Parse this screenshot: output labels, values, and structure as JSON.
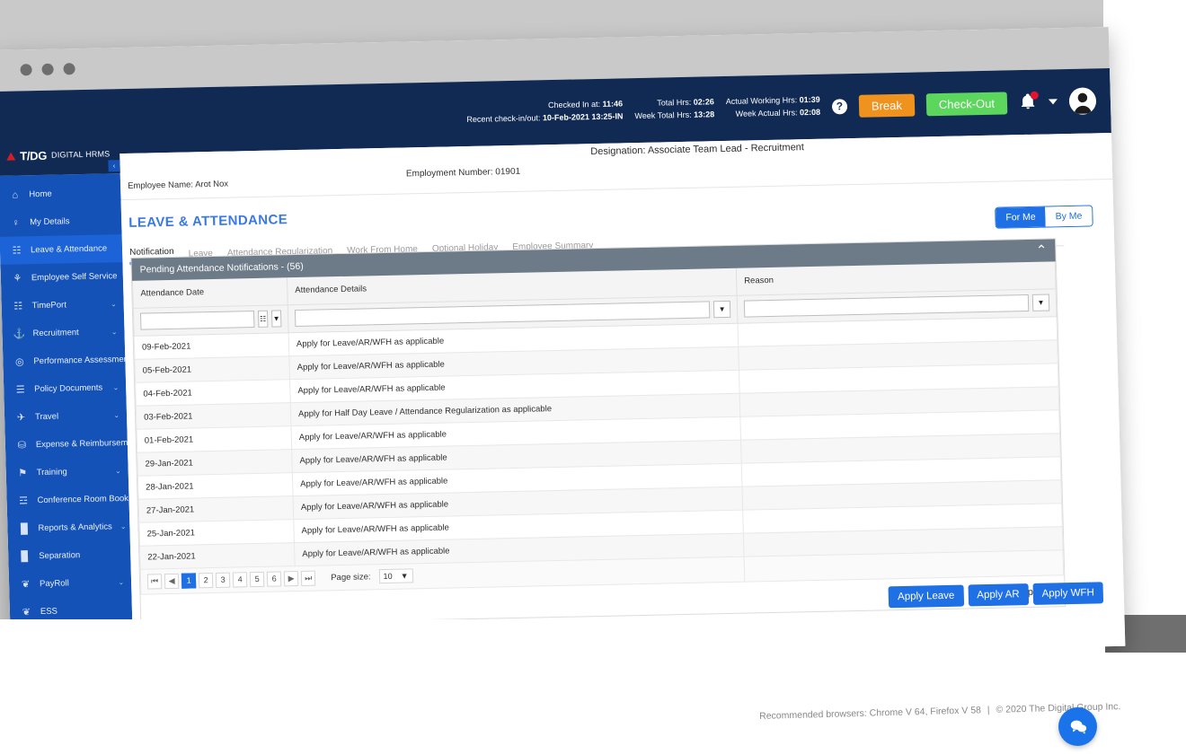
{
  "browser": {
    "status_url": "https://hrm-uat.thedigitalgroup.com/#",
    "dots": [
      "dot-1",
      "dot-2",
      "dot-3"
    ]
  },
  "brand": {
    "logo_mark": "T/DG",
    "logo_sub": "DIGITAL HRMS"
  },
  "header": {
    "checked_in_label": "Checked In at:",
    "checked_in_value": "11:46",
    "recent_label": "Recent check-in/out:",
    "recent_value": "10-Feb-2021 13:25-IN",
    "total_hrs_label": "Total Hrs:",
    "total_hrs_value": "02:26",
    "week_total_label": "Week Total Hrs:",
    "week_total_value": "13:28",
    "actual_working_label": "Actual Working Hrs:",
    "actual_working_value": "01:39",
    "week_actual_label": "Week Actual Hrs:",
    "week_actual_value": "02:08",
    "help_glyph": "?",
    "break_label": "Break",
    "checkout_label": "Check-Out",
    "break_color": "#f0921e",
    "checkout_color": "#5cd65c",
    "designation": "Designation: Associate Team Lead - Recruitment"
  },
  "sidebar": {
    "collapse_glyph": "‹",
    "items": [
      {
        "label": "Home",
        "icon": "home-icon",
        "glyph": "⌂",
        "chevron": "",
        "active": false
      },
      {
        "label": "My Details",
        "icon": "person-icon",
        "glyph": "♀",
        "chevron": "",
        "active": false
      },
      {
        "label": "Leave & Attendance",
        "icon": "calendar-icon",
        "glyph": "☷",
        "chevron": "",
        "active": true
      },
      {
        "label": "Employee Self Service",
        "icon": "people-icon",
        "glyph": "⚘",
        "chevron": "",
        "active": false
      },
      {
        "label": "TimePort",
        "icon": "calendar-clock-icon",
        "glyph": "☷",
        "chevron": "⌄",
        "active": false
      },
      {
        "label": "Recruitment",
        "icon": "handshake-icon",
        "glyph": "⚓",
        "chevron": "⌄",
        "active": false
      },
      {
        "label": "Performance Assessment",
        "icon": "magnifier-icon",
        "glyph": "◎",
        "chevron": "",
        "active": false
      },
      {
        "label": "Policy Documents",
        "icon": "document-icon",
        "glyph": "☰",
        "chevron": "⌄",
        "active": false
      },
      {
        "label": "Travel",
        "icon": "plane-icon",
        "glyph": "✈",
        "chevron": "⌄",
        "active": false
      },
      {
        "label": "Expense & Reimbursement",
        "icon": "wallet-icon",
        "glyph": "⛁",
        "chevron": "⌄",
        "active": false
      },
      {
        "label": "Training",
        "icon": "training-icon",
        "glyph": "⚑",
        "chevron": "⌄",
        "active": false
      },
      {
        "label": "Conference Room Booking",
        "icon": "room-icon",
        "glyph": "☲",
        "chevron": "⌄",
        "active": false
      },
      {
        "label": "Reports & Analytics",
        "icon": "bar-chart-icon",
        "glyph": "█",
        "chevron": "⌄",
        "active": false
      },
      {
        "label": "Separation",
        "icon": "door-icon",
        "glyph": "▉",
        "chevron": "",
        "active": false
      },
      {
        "label": "PayRoll",
        "icon": "money-icon",
        "glyph": "❦",
        "chevron": "⌄",
        "active": false
      },
      {
        "label": "ESS",
        "icon": "money-icon",
        "glyph": "❦",
        "chevron": "",
        "active": false
      }
    ]
  },
  "employee": {
    "name_label": "Employee Name:",
    "name_value": "Arot Nox",
    "number_label": "Employment Number:",
    "number_value": "01901"
  },
  "page": {
    "title": "LEAVE & ATTENDANCE"
  },
  "tabs": [
    {
      "label": "Notification",
      "active": true
    },
    {
      "label": "Leave",
      "active": false
    },
    {
      "label": "Attendance Regularization",
      "active": false
    },
    {
      "label": "Work From Home",
      "active": false
    },
    {
      "label": "Optional Holiday",
      "active": false
    },
    {
      "label": "Employee Summary",
      "active": false
    }
  ],
  "segmented": [
    {
      "label": "For Me",
      "active": true
    },
    {
      "label": "By Me",
      "active": false
    }
  ],
  "panel": {
    "title": "Pending Attendance Notifications - (56)",
    "chevron": "⌃"
  },
  "grid": {
    "columns": [
      "Attendance Date",
      "Attendance Details",
      "Reason"
    ],
    "filters": {
      "date_value": "",
      "details_value": "",
      "reason_value": "",
      "calendar_glyph": "☷",
      "funnel_glyph": "▼"
    },
    "rows": [
      {
        "date": "09-Feb-2021",
        "details": "Apply for Leave/AR/WFH as applicable",
        "reason": ""
      },
      {
        "date": "05-Feb-2021",
        "details": "Apply for Leave/AR/WFH as applicable",
        "reason": ""
      },
      {
        "date": "04-Feb-2021",
        "details": "Apply for Leave/AR/WFH as applicable",
        "reason": ""
      },
      {
        "date": "03-Feb-2021",
        "details": "Apply for Half Day Leave / Attendance Regularization as applicable",
        "reason": ""
      },
      {
        "date": "01-Feb-2021",
        "details": "Apply for Leave/AR/WFH as applicable",
        "reason": ""
      },
      {
        "date": "29-Jan-2021",
        "details": "Apply for Leave/AR/WFH as applicable",
        "reason": ""
      },
      {
        "date": "28-Jan-2021",
        "details": "Apply for Leave/AR/WFH as applicable",
        "reason": ""
      },
      {
        "date": "27-Jan-2021",
        "details": "Apply for Leave/AR/WFH as applicable",
        "reason": ""
      },
      {
        "date": "25-Jan-2021",
        "details": "Apply for Leave/AR/WFH as applicable",
        "reason": ""
      },
      {
        "date": "22-Jan-2021",
        "details": "Apply for Leave/AR/WFH as applicable",
        "reason": ""
      }
    ]
  },
  "pager": {
    "first_glyph": "⏮",
    "prev_glyph": "◀",
    "next_glyph": "▶",
    "last_glyph": "⏭",
    "pages": [
      "1",
      "2",
      "3",
      "4",
      "5",
      "6"
    ],
    "current_page": "1",
    "page_size_label": "Page size:",
    "page_size_value": "10",
    "page_size_caret": "▼",
    "items_summary": "56 items in 6 pages"
  },
  "actions": [
    {
      "label": "Apply Leave",
      "name": "apply-leave-button"
    },
    {
      "label": "Apply AR",
      "name": "apply-ar-button"
    },
    {
      "label": "Apply WFH",
      "name": "apply-wfh-button"
    }
  ],
  "footer": {
    "browsers": "Recommended browsers: Chrome V 64, Firefox V 58",
    "separator": "|",
    "copyright": "© 2020 The Digital Group Inc."
  }
}
